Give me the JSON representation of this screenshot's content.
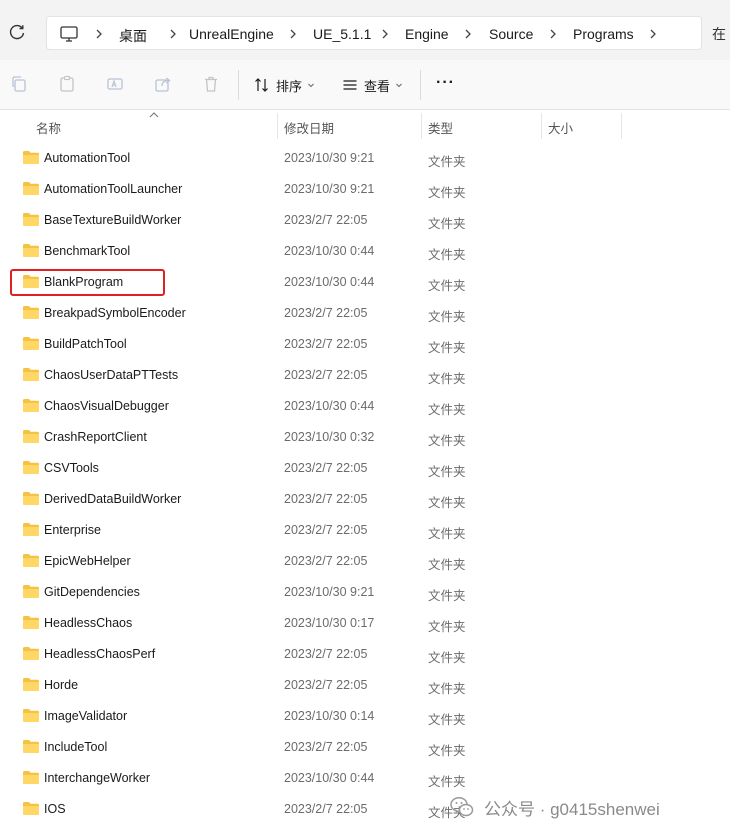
{
  "address_bar": {
    "crumbs": [
      "桌面",
      "UnrealEngine",
      "UE_5.1.1",
      "Engine",
      "Source",
      "Programs"
    ],
    "edge_text": "在"
  },
  "toolbar": {
    "sort_label": "排序",
    "view_label": "查看",
    "more_label": "···"
  },
  "columns": {
    "name": "名称",
    "date": "修改日期",
    "type": "类型",
    "size": "大小"
  },
  "files": [
    {
      "name": "AutomationTool",
      "date": "2023/10/30 9:21",
      "type": "文件夹"
    },
    {
      "name": "AutomationToolLauncher",
      "date": "2023/10/30 9:21",
      "type": "文件夹"
    },
    {
      "name": "BaseTextureBuildWorker",
      "date": "2023/2/7 22:05",
      "type": "文件夹"
    },
    {
      "name": "BenchmarkTool",
      "date": "2023/10/30 0:44",
      "type": "文件夹"
    },
    {
      "name": "BlankProgram",
      "date": "2023/10/30 0:44",
      "type": "文件夹"
    },
    {
      "name": "BreakpadSymbolEncoder",
      "date": "2023/2/7 22:05",
      "type": "文件夹"
    },
    {
      "name": "BuildPatchTool",
      "date": "2023/2/7 22:05",
      "type": "文件夹"
    },
    {
      "name": "ChaosUserDataPTTests",
      "date": "2023/2/7 22:05",
      "type": "文件夹"
    },
    {
      "name": "ChaosVisualDebugger",
      "date": "2023/10/30 0:44",
      "type": "文件夹"
    },
    {
      "name": "CrashReportClient",
      "date": "2023/10/30 0:32",
      "type": "文件夹"
    },
    {
      "name": "CSVTools",
      "date": "2023/2/7 22:05",
      "type": "文件夹"
    },
    {
      "name": "DerivedDataBuildWorker",
      "date": "2023/2/7 22:05",
      "type": "文件夹"
    },
    {
      "name": "Enterprise",
      "date": "2023/2/7 22:05",
      "type": "文件夹"
    },
    {
      "name": "EpicWebHelper",
      "date": "2023/2/7 22:05",
      "type": "文件夹"
    },
    {
      "name": "GitDependencies",
      "date": "2023/10/30 9:21",
      "type": "文件夹"
    },
    {
      "name": "HeadlessChaos",
      "date": "2023/10/30 0:17",
      "type": "文件夹"
    },
    {
      "name": "HeadlessChaosPerf",
      "date": "2023/2/7 22:05",
      "type": "文件夹"
    },
    {
      "name": "Horde",
      "date": "2023/2/7 22:05",
      "type": "文件夹"
    },
    {
      "name": "ImageValidator",
      "date": "2023/10/30 0:14",
      "type": "文件夹"
    },
    {
      "name": "IncludeTool",
      "date": "2023/2/7 22:05",
      "type": "文件夹"
    },
    {
      "name": "InterchangeWorker",
      "date": "2023/10/30 0:44",
      "type": "文件夹"
    },
    {
      "name": "IOS",
      "date": "2023/2/7 22:05",
      "type": "文件夹"
    }
  ],
  "highlighted_file": "BlankProgram",
  "highlight_color": "#e02020",
  "folder_color": "#f5c242",
  "watermark": {
    "text": "公众号 · g0415shenwei"
  }
}
